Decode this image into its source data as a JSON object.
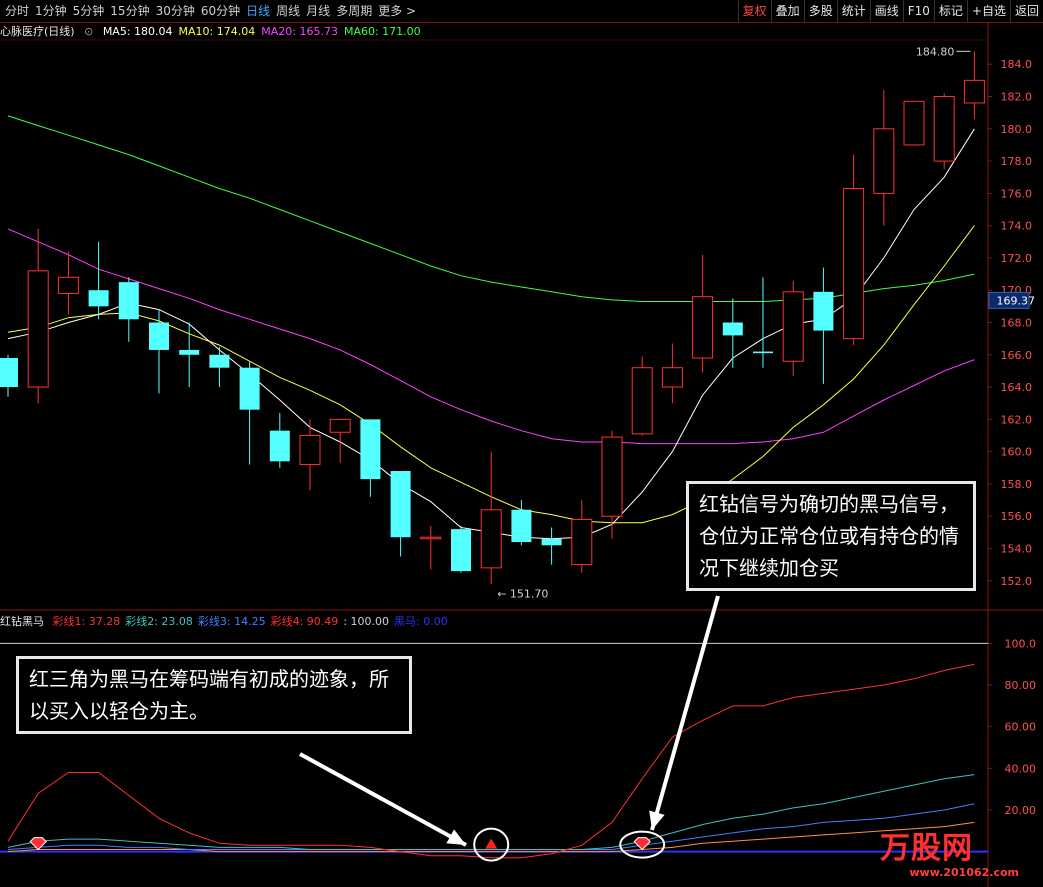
{
  "toolbar": {
    "periods": [
      "分时",
      "1分钟",
      "5分钟",
      "15分钟",
      "30分钟",
      "60分钟",
      "日线",
      "周线",
      "月线",
      "多周期",
      "更多 >"
    ],
    "active_period": "日线",
    "actions": [
      "复权",
      "叠加",
      "多股",
      "统计",
      "画线",
      "F10",
      "标记",
      "+自选",
      "返回"
    ]
  },
  "title": "心脉医疗(日线)",
  "ma": [
    {
      "label": "MA5: 180.04",
      "color": "#ffffff"
    },
    {
      "label": "MA10: 174.04",
      "color": "#ffff40"
    },
    {
      "label": "MA20: 165.73",
      "color": "#ff40ff"
    },
    {
      "label": "MA60: 171.00",
      "color": "#40ff40"
    }
  ],
  "price_axis": [
    "184.0",
    "182.0",
    "180.0",
    "178.0",
    "176.0",
    "174.0",
    "172.0",
    "170.0",
    "168.0",
    "166.0",
    "164.0",
    "162.0",
    "160.0",
    "158.0",
    "156.0",
    "154.0",
    "152.0"
  ],
  "current_price": "169.37",
  "high_label": "184.80",
  "low_label": "151.70",
  "indicator": {
    "name": "红钻黑马",
    "lines": [
      {
        "label": "彩线1: 37.28",
        "color": "#ff3030"
      },
      {
        "label": "彩线2: 23.08",
        "color": "#40c0c0"
      },
      {
        "label": "彩线3: 14.25",
        "color": "#4080ff"
      },
      {
        "label": "彩线4: 90.49",
        "color": "#ff3030"
      },
      {
        "label": ": 100.00",
        "color": "#d0d0d0"
      },
      {
        "label": "黑马: 0.00",
        "color": "#3030ff"
      }
    ],
    "axis": [
      "100.0",
      "80.00",
      "60.00",
      "40.00",
      "20.00"
    ]
  },
  "callouts": {
    "right": "红钻信号为确切的黑马信号，仓位为正常仓位或有持仓的情况下继续加仓买",
    "left": "红三角为黑马在筹码端有初成的迹象，所以买入以轻仓为主。"
  },
  "logo": {
    "text": "万股网",
    "sub": "www.201062.com"
  },
  "chart_data": {
    "type": "candlestick",
    "ylim": [
      150.5,
      185.5
    ],
    "candles": [
      [
        165.8,
        164.0,
        163.4,
        166.0
      ],
      [
        164.0,
        171.2,
        163.0,
        173.8
      ],
      [
        169.8,
        170.8,
        168.5,
        172.4
      ],
      [
        170.0,
        169.0,
        168.2,
        173.0
      ],
      [
        170.5,
        168.2,
        166.8,
        170.8
      ],
      [
        168.0,
        166.3,
        163.6,
        168.8
      ],
      [
        166.3,
        166.0,
        164.0,
        168.0
      ],
      [
        166.0,
        165.2,
        164.0,
        166.5
      ],
      [
        165.2,
        162.6,
        159.2,
        165.6
      ],
      [
        161.3,
        159.4,
        159.0,
        162.4
      ],
      [
        159.2,
        161.0,
        157.6,
        162.0
      ],
      [
        161.2,
        162.0,
        159.3,
        162.0
      ],
      [
        162.0,
        158.3,
        157.2,
        162.0
      ],
      [
        158.8,
        154.7,
        153.5,
        158.8
      ],
      [
        154.7,
        154.7,
        152.7,
        155.4
      ],
      [
        155.2,
        152.6,
        152.5,
        155.4
      ],
      [
        152.8,
        156.4,
        151.8,
        160.0
      ],
      [
        156.4,
        154.4,
        154.2,
        157.0
      ],
      [
        154.6,
        154.2,
        153.0,
        155.3
      ],
      [
        153.0,
        155.8,
        152.5,
        157.0
      ],
      [
        156.0,
        160.9,
        154.6,
        161.3
      ],
      [
        161.1,
        165.2,
        161.0,
        165.9
      ],
      [
        164.0,
        165.2,
        163.0,
        166.7
      ],
      [
        165.8,
        169.6,
        164.9,
        172.2
      ],
      [
        168.0,
        167.2,
        165.2,
        169.5
      ],
      [
        166.2,
        166.1,
        165.2,
        170.8
      ],
      [
        165.6,
        169.9,
        164.7,
        170.6
      ],
      [
        169.9,
        167.5,
        164.2,
        171.4
      ],
      [
        167.0,
        176.3,
        166.6,
        178.4
      ],
      [
        176.0,
        180.0,
        174.0,
        182.4
      ],
      [
        179.0,
        181.7,
        179.0,
        181.7
      ],
      [
        178.0,
        182.0,
        177.5,
        182.2
      ],
      [
        181.6,
        183.0,
        180.6,
        184.8
      ]
    ],
    "ma5": [
      167.0,
      167.4,
      168.0,
      168.5,
      169.2,
      168.8,
      167.9,
      166.3,
      164.8,
      163.2,
      161.5,
      160.6,
      159.5,
      158.0,
      156.9,
      155.3,
      155.0,
      154.7,
      154.6,
      154.7,
      155.5,
      157.5,
      160.0,
      163.5,
      165.8,
      167.0,
      167.9,
      168.2,
      169.5,
      172.0,
      175.0,
      177.0,
      180.0
    ],
    "ma10": [
      167.4,
      167.7,
      168.3,
      168.5,
      168.6,
      168.1,
      167.3,
      166.6,
      165.6,
      164.6,
      163.8,
      162.9,
      161.7,
      160.3,
      159.0,
      158.1,
      157.2,
      156.4,
      156.1,
      155.7,
      155.6,
      155.6,
      156.1,
      157.0,
      158.3,
      159.7,
      161.5,
      162.9,
      164.5,
      166.6,
      169.1,
      171.5,
      174.0
    ],
    "ma20": [
      173.8,
      173.0,
      172.2,
      171.3,
      170.7,
      170.1,
      169.5,
      168.8,
      168.2,
      167.6,
      167.0,
      166.3,
      165.4,
      164.4,
      163.4,
      162.6,
      161.9,
      161.3,
      160.8,
      160.6,
      160.6,
      160.5,
      160.5,
      160.5,
      160.5,
      160.6,
      160.8,
      161.2,
      162.2,
      163.2,
      164.1,
      165.0,
      165.7
    ],
    "ma60": [
      180.8,
      180.2,
      179.6,
      179.0,
      178.4,
      177.7,
      177.0,
      176.3,
      175.7,
      175.0,
      174.3,
      173.6,
      172.9,
      172.2,
      171.5,
      170.9,
      170.5,
      170.2,
      169.9,
      169.6,
      169.4,
      169.3,
      169.3,
      169.3,
      169.3,
      169.3,
      169.4,
      169.5,
      169.8,
      170.1,
      170.3,
      170.6,
      171.0
    ]
  },
  "indicator_data": {
    "ylim": [
      -5,
      105
    ],
    "line1": [
      5,
      28,
      38,
      38,
      27,
      16,
      9,
      4,
      3,
      3,
      3,
      3,
      2,
      0,
      -2,
      -2,
      -3,
      -3,
      -1,
      3,
      14,
      35,
      55,
      63,
      70,
      70,
      74,
      76,
      78,
      80,
      83,
      87,
      90
    ],
    "line2": [
      2,
      5,
      6,
      6,
      5,
      4,
      3,
      2,
      2,
      2,
      1,
      1,
      1,
      1,
      1,
      1,
      1,
      1,
      1,
      1,
      2,
      5,
      9,
      13,
      16,
      18,
      21,
      23,
      26,
      29,
      32,
      35,
      37
    ],
    "line3": [
      1,
      2,
      3,
      3,
      2,
      2,
      1,
      1,
      1,
      1,
      1,
      1,
      1,
      1,
      1,
      1,
      1,
      1,
      1,
      1,
      1,
      3,
      5,
      7,
      9,
      11,
      12,
      14,
      15,
      16,
      18,
      20,
      23
    ],
    "line4": [
      0,
      1,
      1,
      1,
      1,
      1,
      1,
      0,
      0,
      0,
      0,
      0,
      0,
      0,
      0,
      0,
      0,
      0,
      0,
      0,
      0,
      1,
      2,
      4,
      5,
      6,
      7,
      8,
      9,
      10,
      11,
      12,
      14
    ],
    "signals": [
      {
        "type": "diamond",
        "index": 1
      },
      {
        "type": "triangle",
        "index": 16
      },
      {
        "type": "diamond",
        "index": 21
      }
    ]
  }
}
